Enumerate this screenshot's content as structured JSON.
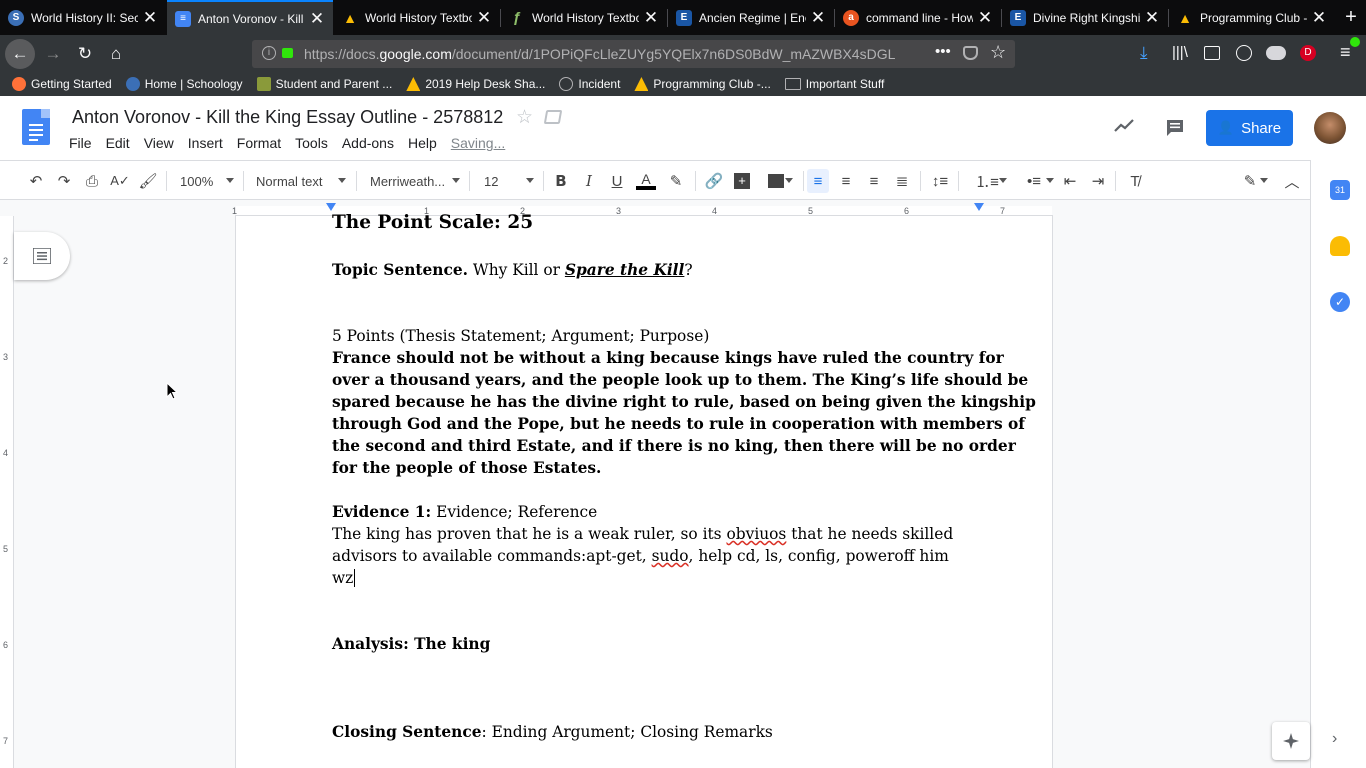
{
  "browser": {
    "tabs": [
      {
        "title": "World History II: Sec",
        "favicon": "schoology-icon",
        "color": "#3b6fb6",
        "glyph": "S"
      },
      {
        "title": "Anton Voronov - Kill t",
        "favicon": "google-docs-icon",
        "color": "#4285f4",
        "glyph": "≡"
      },
      {
        "title": "World History Textbo",
        "favicon": "google-drive-icon",
        "color": "#fbbc04",
        "glyph": "▲"
      },
      {
        "title": "World History Textbo",
        "favicon": "pdf-icon",
        "color": "#6d8f5a",
        "glyph": "ƒ"
      },
      {
        "title": "Ancien Regime | Enc",
        "favicon": "britannica-icon",
        "color": "#1a56a5",
        "glyph": "E"
      },
      {
        "title": "command line - How",
        "favicon": "askubuntu-icon",
        "color": "#e95420",
        "glyph": "a"
      },
      {
        "title": "Divine Right Kingshi",
        "favicon": "britannica-icon",
        "color": "#1a56a5",
        "glyph": "E"
      },
      {
        "title": "Programming Club -",
        "favicon": "google-drive-icon",
        "color": "#fbbc04",
        "glyph": "▲"
      }
    ],
    "url": {
      "prefix": "https://docs.",
      "domain": "google.com",
      "path": "/document/d/1POPiQFcLleZUYg5YQElx7n6DS0BdW_mAZWBX4sDGL"
    },
    "bookmarks": [
      {
        "label": "Getting Started",
        "icon": "firefox-icon",
        "color": "#ff7139"
      },
      {
        "label": "Home | Schoology",
        "icon": "schoology-icon",
        "color": "#3b6fb6"
      },
      {
        "label": "Student and Parent ...",
        "icon": "powerschool-icon",
        "color": "#8a9a3a"
      },
      {
        "label": "2019 Help Desk Sha...",
        "icon": "google-drive-icon",
        "color": "#fbbc04"
      },
      {
        "label": "Incident",
        "icon": "globe-icon",
        "color": "#8e8e93"
      },
      {
        "label": "Programming Club -...",
        "icon": "google-drive-icon",
        "color": "#fbbc04"
      },
      {
        "label": "Important Stuff",
        "icon": "folder-icon",
        "color": "#b1b1b3"
      }
    ]
  },
  "docs": {
    "title": "Anton Voronov - Kill the King Essay Outline - 2578812",
    "menus": [
      "File",
      "Edit",
      "View",
      "Insert",
      "Format",
      "Tools",
      "Add-ons",
      "Help"
    ],
    "status": "Saving...",
    "share_label": "Share",
    "toolbar": {
      "zoom": "100%",
      "style": "Normal text",
      "font": "Merriweath...",
      "size": "12"
    },
    "ruler_numbers": [
      "1",
      "1",
      "2",
      "3",
      "4",
      "5",
      "6",
      "7"
    ],
    "vruler_numbers": [
      "2",
      "3",
      "4",
      "5",
      "6",
      "7"
    ]
  },
  "document": {
    "point_scale": "The Point Scale: 25",
    "topic_label": "Topic Sentence.",
    "topic_text": " Why Kill or ",
    "topic_italic": "Spare the Kill",
    "topic_end": "?",
    "thesis_heading": "5 Points (Thesis Statement; Argument; Purpose)",
    "thesis_lines": [
      "France should not be without a king because kings have ruled the country for",
      "over a thousand years, and the people look up to them. The King’s life should be",
      "spared because  he has the divine right to rule, based on being given the kingship",
      "through God and the Pope, but he needs to rule in cooperation with members of",
      "the second and third Estate, and if there is no king, then there will be no order",
      "for the people of those Estates."
    ],
    "evidence_label": "Evidence 1:",
    "evidence_text": " Evidence; Reference",
    "evidence_line1_a": "The king has proven that he is a weak ruler, so ",
    "evidence_line1_b": "its",
    "evidence_line1_c": " ",
    "evidence_line1_d": "obviuos",
    "evidence_line1_e": " that he needs skilled",
    "evidence_line2_a": "advisors to available commands:apt-get, ",
    "evidence_line2_b": "sudo",
    "evidence_line2_c": ", help cd, ls, config, poweroff him",
    "evidence_line3": "wz",
    "analysis": "Analysis: The king",
    "closing_label": "Closing Sentence",
    "closing_text": ": Ending Argument; Closing Remarks"
  }
}
